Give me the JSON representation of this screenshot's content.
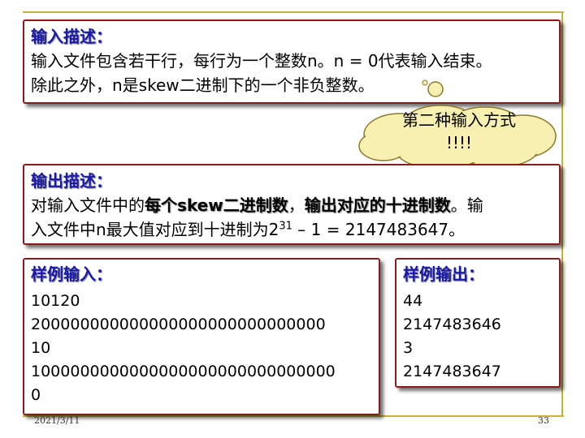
{
  "input_section": {
    "heading": "输入描述：",
    "line1": "输入文件包含若干行，每行为一个整数n。n = 0代表输入结束。",
    "line2": "除此之外，n是skew二进制下的一个非负整数。"
  },
  "callout": {
    "line1": "第二种输入方式",
    "line2": "!!!!"
  },
  "output_section": {
    "heading": "输出描述：",
    "prefix": "对输入文件中的",
    "bold1": "每个skew二进制数",
    "comma": "，",
    "bold2": "输出对应的十进制数",
    "suffix": "。输",
    "line2_prefix": "入文件中n最大值对应到十进制为2",
    "exponent": "31",
    "line2_suffix": " – 1 = 2147483647。"
  },
  "sample_input": {
    "heading": "样例输入：",
    "lines": [
      "10120",
      "200000000000000000000000000000",
      "10",
      "1000000000000000000000000000000",
      "0"
    ]
  },
  "sample_output": {
    "heading": "样例输出：",
    "lines": [
      "44",
      "2147483646",
      "3",
      "2147483647"
    ]
  },
  "footer": {
    "date": "2021/3/11",
    "page": "33"
  }
}
